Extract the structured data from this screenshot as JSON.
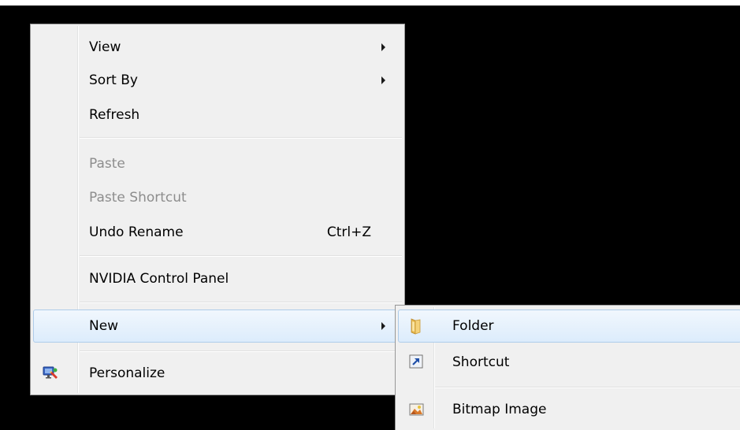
{
  "context_menu": {
    "items": [
      {
        "label": "View",
        "submenu": true
      },
      {
        "label": "Sort By",
        "submenu": true
      },
      {
        "label": "Refresh"
      },
      {
        "label": "Paste",
        "disabled": true
      },
      {
        "label": "Paste Shortcut",
        "disabled": true
      },
      {
        "label": "Undo Rename",
        "shortcut": "Ctrl+Z"
      },
      {
        "label": "NVIDIA Control Panel"
      },
      {
        "label": "New",
        "submenu": true,
        "highlighted": true
      },
      {
        "label": "Personalize",
        "icon": "personalize-icon"
      }
    ]
  },
  "new_submenu": {
    "items": [
      {
        "label": "Folder",
        "icon": "folder-icon",
        "highlighted": true
      },
      {
        "label": "Shortcut",
        "icon": "shortcut-icon"
      },
      {
        "label": "Bitmap Image",
        "icon": "bitmap-image-icon"
      }
    ]
  },
  "colors": {
    "desktop_background": "#000000",
    "menu_background": "#f0f0f0",
    "highlight_border": "#aeccea",
    "disabled_text": "#8d8d8d"
  }
}
